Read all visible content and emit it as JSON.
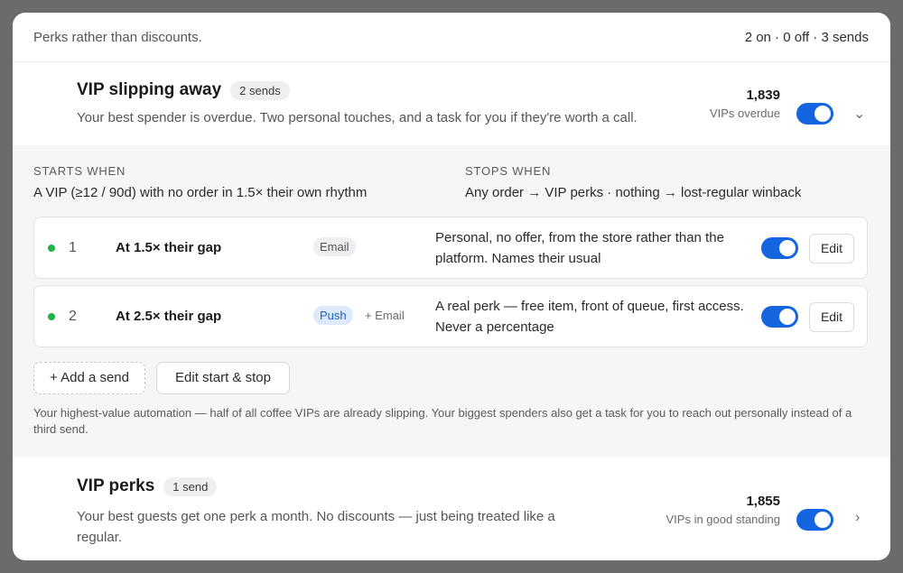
{
  "header": {
    "note": "Perks rather than discounts.",
    "counts": "2 on · 0 off · 3 sends"
  },
  "automations": [
    {
      "title": "VIP slipping away",
      "sends_badge": "2 sends",
      "description": "Your best spender is overdue. Two personal touches, and a task for you if they're worth a call.",
      "stat_value": "1,839",
      "stat_label": "VIPs overdue",
      "enabled": true,
      "chevron_icon": "chevron-down-icon",
      "details": {
        "starts_label": "STARTS WHEN",
        "starts_text": "A VIP (≥12 / 90d) with no order in 1.5× their own rhythm",
        "stops_label": "STOPS WHEN",
        "stops_text": "Any order → VIP perks · nothing → lost-regular winback",
        "steps": [
          {
            "index": "1",
            "when": "At 1.5× their gap",
            "channel": "Email",
            "extra_channel": "",
            "copy": "Personal, no offer, from the store rather than the platform. Names their usual",
            "enabled": true,
            "edit_label": "Edit"
          },
          {
            "index": "2",
            "when": "At 2.5× their gap",
            "channel": "Push",
            "extra_channel": "+ Email",
            "copy": "A real perk — free item, front of queue, first access. Never a percentage",
            "enabled": true,
            "edit_label": "Edit"
          }
        ],
        "add_send_label": "+ Add a send",
        "edit_start_stop_label": "Edit start & stop",
        "footnote": "Your highest-value automation — half of all coffee VIPs are already slipping. Your biggest spenders also get a task for you to reach out personally instead of a third send."
      }
    },
    {
      "title": "VIP perks",
      "sends_badge": "1 send",
      "description": "Your best guests get one perk a month. No discounts — just being treated like a regular.",
      "stat_value": "1,855",
      "stat_label": "VIPs in good standing",
      "enabled": true,
      "chevron_icon": "chevron-right-icon"
    }
  ],
  "colors": {
    "toggle_on": "#1565e0",
    "status_dot": "#22b24c",
    "push_chip": "#dceafc"
  }
}
